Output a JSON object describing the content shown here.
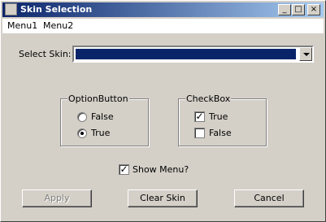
{
  "window": {
    "title": "Skin Selection",
    "minimize": "_",
    "maximize": "□",
    "close": "×"
  },
  "menu": {
    "items": [
      "Menu1",
      "Menu2"
    ]
  },
  "skin": {
    "label": "Select Skin:",
    "value": ""
  },
  "option_group": {
    "title": "OptionButton",
    "options": [
      "False",
      "True"
    ],
    "selected": "True"
  },
  "check_group": {
    "title": "CheckBox",
    "items": [
      {
        "label": "True",
        "checked": true
      },
      {
        "label": "False",
        "checked": false
      }
    ]
  },
  "show_menu": {
    "label": "Show Menu?",
    "checked": true
  },
  "buttons": {
    "apply": "Apply",
    "clear": "Clear Skin",
    "cancel": "Cancel"
  },
  "colors": {
    "title_start": "#0a246a",
    "title_end": "#a6caf0",
    "face": "#d4d0c8"
  }
}
